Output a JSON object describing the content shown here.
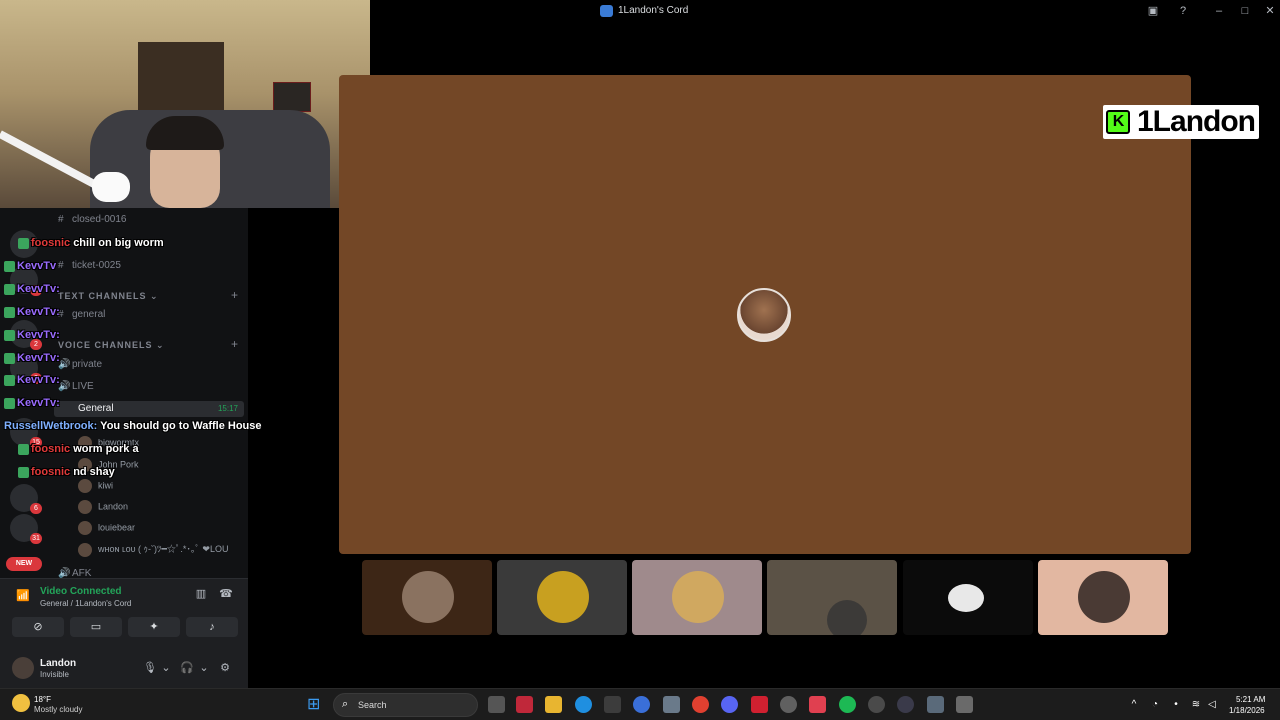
{
  "window": {
    "title": "1Landon's Cord",
    "controls": [
      "screen-share-icon",
      "help-icon",
      "minimize-icon",
      "maximize-icon",
      "close-icon"
    ]
  },
  "channels": {
    "items": [
      {
        "label": "closed-0016",
        "type": "text"
      },
      {
        "label": "ticket-0025",
        "type": "text"
      }
    ],
    "text_category": "TEXT CHANNELS",
    "text_channels": [
      {
        "label": "general"
      }
    ],
    "voice_category": "VOICE CHANNELS",
    "voice_channels": [
      {
        "label": "private"
      },
      {
        "label": "LIVE"
      },
      {
        "label": "General",
        "time": "15:17",
        "active": true
      }
    ],
    "voice_users": [
      "bigwormtx",
      "John Pork",
      "kiwi",
      "Landon",
      "louiebear",
      "ᴡʜᴏɴ ʟᴏᴜ ( ｩ-ˇ)ﾂ━☆ﾟ.*･｡ﾟ ❤LOU"
    ],
    "afk_label": "AFK"
  },
  "guild_badges": [
    "1",
    "2",
    "2",
    "15",
    "6",
    "31"
  ],
  "new_pill": "NEW",
  "chat": [
    {
      "user": "foosnic",
      "color": "red",
      "message": "chill on big worm"
    },
    {
      "user": "KevvTv",
      "color": "purple",
      "message": ""
    },
    {
      "user": "KevvTv:",
      "color": "purple",
      "message": ""
    },
    {
      "user": "KevvTv:",
      "color": "purple",
      "message": ""
    },
    {
      "user": "KevvTv:",
      "color": "purple",
      "message": ""
    },
    {
      "user": "KevvTv:",
      "color": "purple",
      "message": ""
    },
    {
      "user": "KevvTv:",
      "color": "purple",
      "message": ""
    },
    {
      "user": "KevvTv:",
      "color": "purple",
      "message": ""
    },
    {
      "user": "RussellWetbrook:",
      "color": "blue",
      "message": "You should go to Waffle House"
    },
    {
      "user": "foosnic",
      "color": "red",
      "message": "worm pork a"
    },
    {
      "user": "foosnic",
      "color": "red",
      "message": "nd shay"
    }
  ],
  "voice_panel": {
    "status": "Video Connected",
    "location": "General / 1Landon's Cord",
    "buttons": [
      "camera-off-icon",
      "screen-share-icon",
      "activities-icon",
      "soundboard-icon"
    ]
  },
  "user": {
    "name": "Landon",
    "status": "Invisible"
  },
  "stage": {
    "background": "#734726",
    "brand_tag": "1Landon",
    "brand_k": "K"
  },
  "tiles": [
    {
      "name": "tile-1",
      "bg": "#3d2616"
    },
    {
      "name": "tile-2",
      "bg": "#3a3a3a"
    },
    {
      "name": "tile-3",
      "bg": "#9f8a8c"
    },
    {
      "name": "tile-4",
      "bg": "#5b5246"
    },
    {
      "name": "tile-5",
      "bg": "#0b0b0b"
    },
    {
      "name": "tile-6",
      "bg": "#e2b7a1"
    }
  ],
  "taskbar": {
    "temperature": "18°F",
    "weather": "Mostly cloudy",
    "search_placeholder": "Search",
    "time": "5:21 AM",
    "date": "1/18/2026"
  }
}
